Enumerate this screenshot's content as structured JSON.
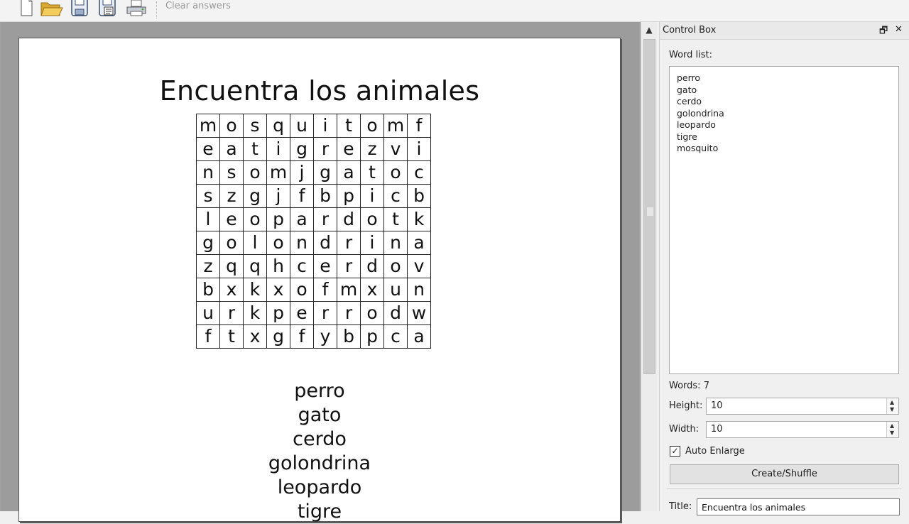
{
  "toolbar": {
    "icons": [
      "new-document-icon",
      "open-folder-icon",
      "save-icon",
      "export-pdf-icon",
      "print-icon"
    ],
    "clear_answers_label": "Clear answers"
  },
  "document": {
    "title": "Encuentra los animales",
    "grid": [
      [
        "m",
        "o",
        "s",
        "q",
        "u",
        "i",
        "t",
        "o",
        "m",
        "f"
      ],
      [
        "e",
        "a",
        "t",
        "i",
        "g",
        "r",
        "e",
        "z",
        "v",
        "i"
      ],
      [
        "n",
        "s",
        "o",
        "m",
        "j",
        "g",
        "a",
        "t",
        "o",
        "c"
      ],
      [
        "s",
        "z",
        "g",
        "j",
        "f",
        "b",
        "p",
        "i",
        "c",
        "b"
      ],
      [
        "l",
        "e",
        "o",
        "p",
        "a",
        "r",
        "d",
        "o",
        "t",
        "k"
      ],
      [
        "g",
        "o",
        "l",
        "o",
        "n",
        "d",
        "r",
        "i",
        "n",
        "a"
      ],
      [
        "z",
        "q",
        "q",
        "h",
        "c",
        "e",
        "r",
        "d",
        "o",
        "v"
      ],
      [
        "b",
        "x",
        "k",
        "x",
        "o",
        "f",
        "m",
        "x",
        "u",
        "n"
      ],
      [
        "u",
        "r",
        "k",
        "p",
        "e",
        "r",
        "r",
        "o",
        "d",
        "w"
      ],
      [
        "f",
        "t",
        "x",
        "g",
        "f",
        "y",
        "b",
        "p",
        "c",
        "a"
      ]
    ],
    "words": [
      "perro",
      "gato",
      "cerdo",
      "golondrina",
      "leopardo",
      "tigre"
    ]
  },
  "control_box": {
    "title": "Control Box",
    "restore_icon": "restore-icon",
    "close_icon": "close-icon",
    "word_list_label": "Word list:",
    "word_list": [
      "perro",
      "gato",
      "cerdo",
      "golondrina",
      "leopardo",
      "tigre",
      "mosquito"
    ],
    "words_count": "Words: 7",
    "height_label": "Height:",
    "height_value": "10",
    "width_label": "Width:",
    "width_value": "10",
    "auto_enlarge_label": "Auto Enlarge",
    "auto_enlarge_checked": true,
    "create_button": "Create/Shuffle",
    "title_label": "Title:",
    "title_value": "Encuentra los animales"
  }
}
